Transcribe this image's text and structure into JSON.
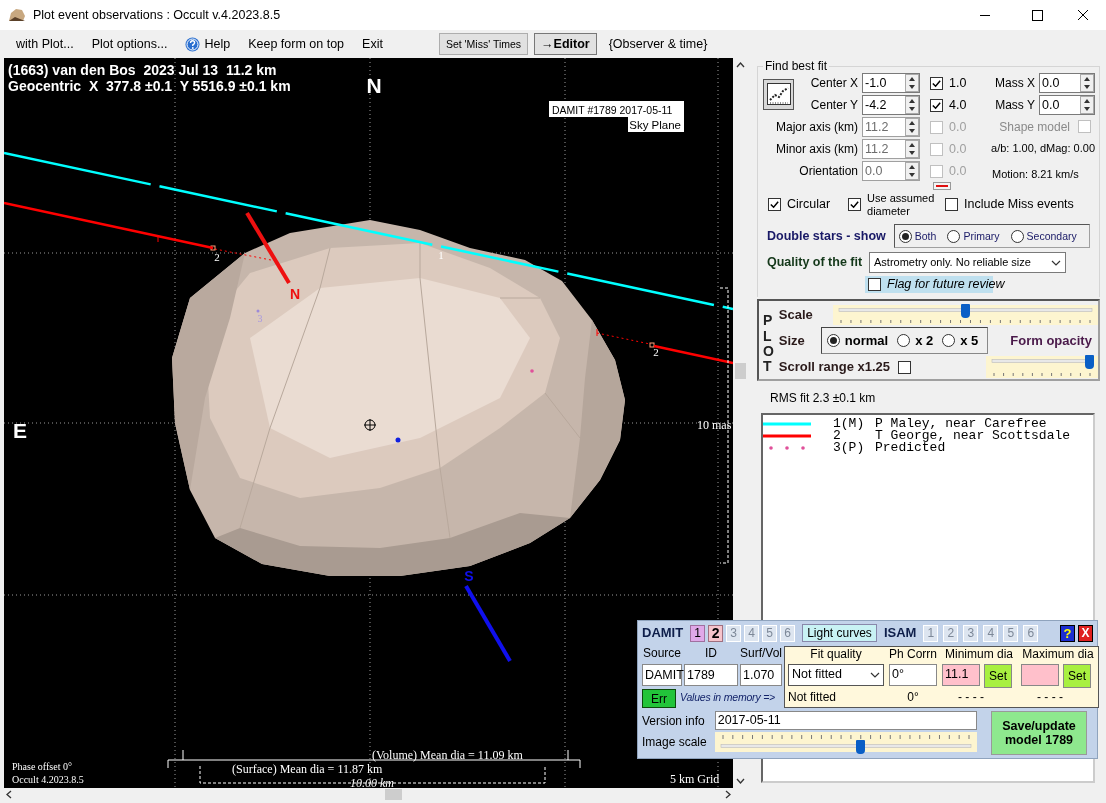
{
  "window": {
    "title": "Plot event observations : Occult v.4.2023.8.5"
  },
  "menu": [
    {
      "kind": "menu",
      "label": "with Plot..."
    },
    {
      "kind": "menu",
      "label": "Plot options..."
    },
    {
      "kind": "help",
      "label": "Help"
    },
    {
      "kind": "menu",
      "label": "Keep form on top"
    },
    {
      "kind": "menu",
      "label": "Exit"
    },
    {
      "kind": "button",
      "label": "Set 'Miss' Times"
    },
    {
      "kind": "bold_button",
      "label": "→Editor"
    },
    {
      "kind": "text",
      "label": "{Observer & time}"
    }
  ],
  "plot": {
    "heading": [
      "(1663) van den Bos  2023 Jul 13  11.2 km",
      "Geocentric  X  377.8 ±0.1  Y 5516.9 ±0.1 km"
    ],
    "north": "N",
    "east": "E",
    "model": [
      "DAMIT #1789 2017-05-11",
      "Sky Plane"
    ],
    "pole_north": "N",
    "pole_south": "S",
    "chords": [
      {
        "labels": [
          "1"
        ],
        "color": "#00ffff"
      },
      {
        "labels": [
          "2",
          "2"
        ],
        "color": "#ff0000"
      },
      {
        "labels": [
          "3"
        ],
        "color": "#e0509a"
      }
    ],
    "scale_label": "10 mas",
    "volume_dia": "(Volume) Mean dia = 11.09 km",
    "surface_dia": "(Surface) Mean dia = 11.87 km",
    "scale_bar": "10.00 km",
    "phase_offset": "Phase offset 0°",
    "version": "Occult 4.2023.8.5",
    "grid": "5 km Grid"
  },
  "fit": {
    "title": "Find best fit",
    "rows": [
      {
        "label": "Center X",
        "value": "-1.0",
        "check_label": "1.0",
        "checked": true,
        "disabled": false
      },
      {
        "label": "Center Y",
        "value": "-4.2",
        "check_label": "4.0",
        "checked": true,
        "disabled": false
      },
      {
        "label": "Major axis (km)",
        "value": "11.2",
        "check_label": "0.0",
        "checked": false,
        "disabled": true
      },
      {
        "label": "Minor axis (km)",
        "value": "11.2",
        "check_label": "0.0",
        "checked": false,
        "disabled": true
      },
      {
        "label": "Orientation",
        "value": "0.0",
        "check_label": "0.0",
        "checked": false,
        "disabled": true
      }
    ],
    "mass": [
      {
        "label": "Mass X",
        "value": "0.0"
      },
      {
        "label": "Mass Y",
        "value": "0.0"
      }
    ],
    "shape_model": {
      "label": "Shape model",
      "checked": false
    },
    "ratio": "a/b: 1.00, dMag: 0.00",
    "motion": "Motion: 8.21 km/s",
    "options": [
      {
        "label": "Circular",
        "checked": true
      },
      {
        "label": "Use assumed diameter",
        "checked": true
      },
      {
        "label": "Include Miss events",
        "checked": false
      }
    ],
    "double_stars": {
      "label": "Double stars - show",
      "options": [
        {
          "label": "Both",
          "selected": true
        },
        {
          "label": "Primary",
          "selected": false
        },
        {
          "label": "Secondary",
          "selected": false
        }
      ]
    },
    "quality": {
      "label": "Quality of the fit",
      "value": "Astrometry only. No reliable size"
    },
    "flag": {
      "label": "Flag for future review",
      "checked": false
    }
  },
  "plot_panel": {
    "letters": "PLOT",
    "scale": {
      "label": "Scale",
      "level": 0.5
    },
    "size": {
      "label": "Size",
      "options": [
        {
          "label": "normal",
          "selected": true
        },
        {
          "label": "x 2",
          "selected": false
        },
        {
          "label": "x 5",
          "selected": false
        }
      ]
    },
    "opacity": {
      "label": "Form opacity",
      "level": 1.0
    },
    "scroll_range": {
      "label": "Scroll range x1.25",
      "checked": false
    }
  },
  "rms": "RMS fit 2.3 ±0.1 km",
  "legend": [
    {
      "kind": "line",
      "color": "#00ffff",
      "number": "1(M)",
      "name": "P Maley, near Carefree"
    },
    {
      "kind": "line",
      "color": "#ff0000",
      "number": "2",
      "name": "T George, near Scottsdale"
    },
    {
      "kind": "dots",
      "color": "#e0509a",
      "number": "3(P)",
      "name": "Predicted"
    }
  ],
  "shape_panel": {
    "damit": {
      "label": "DAMIT",
      "models": [
        {
          "label": "1",
          "selected": false,
          "available": true
        },
        {
          "label": "2",
          "selected": true,
          "available": true
        },
        {
          "label": "3",
          "selected": false,
          "available": false
        },
        {
          "label": "4",
          "selected": false,
          "available": false
        },
        {
          "label": "5",
          "selected": false,
          "available": false
        },
        {
          "label": "6",
          "selected": false,
          "available": false
        }
      ]
    },
    "light_curves": "Light curves",
    "isam": {
      "label": "ISAM",
      "models": [
        {
          "label": "1",
          "selected": false,
          "available": false
        },
        {
          "label": "2",
          "selected": false,
          "available": false
        },
        {
          "label": "3",
          "selected": false,
          "available": false
        },
        {
          "label": "4",
          "selected": false,
          "available": false
        },
        {
          "label": "5",
          "selected": false,
          "available": false
        },
        {
          "label": "6",
          "selected": false,
          "available": false
        }
      ]
    },
    "help": "?",
    "close": "X",
    "source": {
      "label": "Source",
      "value": "DAMIT"
    },
    "id": {
      "label": "ID",
      "value": "1789"
    },
    "surf_vol": {
      "label": "Surf/Vol",
      "value": "1.070"
    },
    "fit_quality": {
      "label": "Fit quality",
      "value": "Not fitted",
      "memory": "Not fitted"
    },
    "ph_corr": {
      "label": "Ph Corrn",
      "value": "0°",
      "memory": "0°"
    },
    "min_dia": {
      "label": "Minimum dia",
      "value": "11.1",
      "button": "Set",
      "memory": "- - - -"
    },
    "max_dia": {
      "label": "Maximum dia",
      "button": "Set",
      "memory": "- - - -"
    },
    "err": "Err",
    "memory_note": "Values in memory =>",
    "version": {
      "label": "Version info",
      "value": "2017-05-11"
    },
    "image_scale": {
      "label": "Image scale",
      "level": 0.56
    },
    "save": "Save/update model 1789"
  }
}
